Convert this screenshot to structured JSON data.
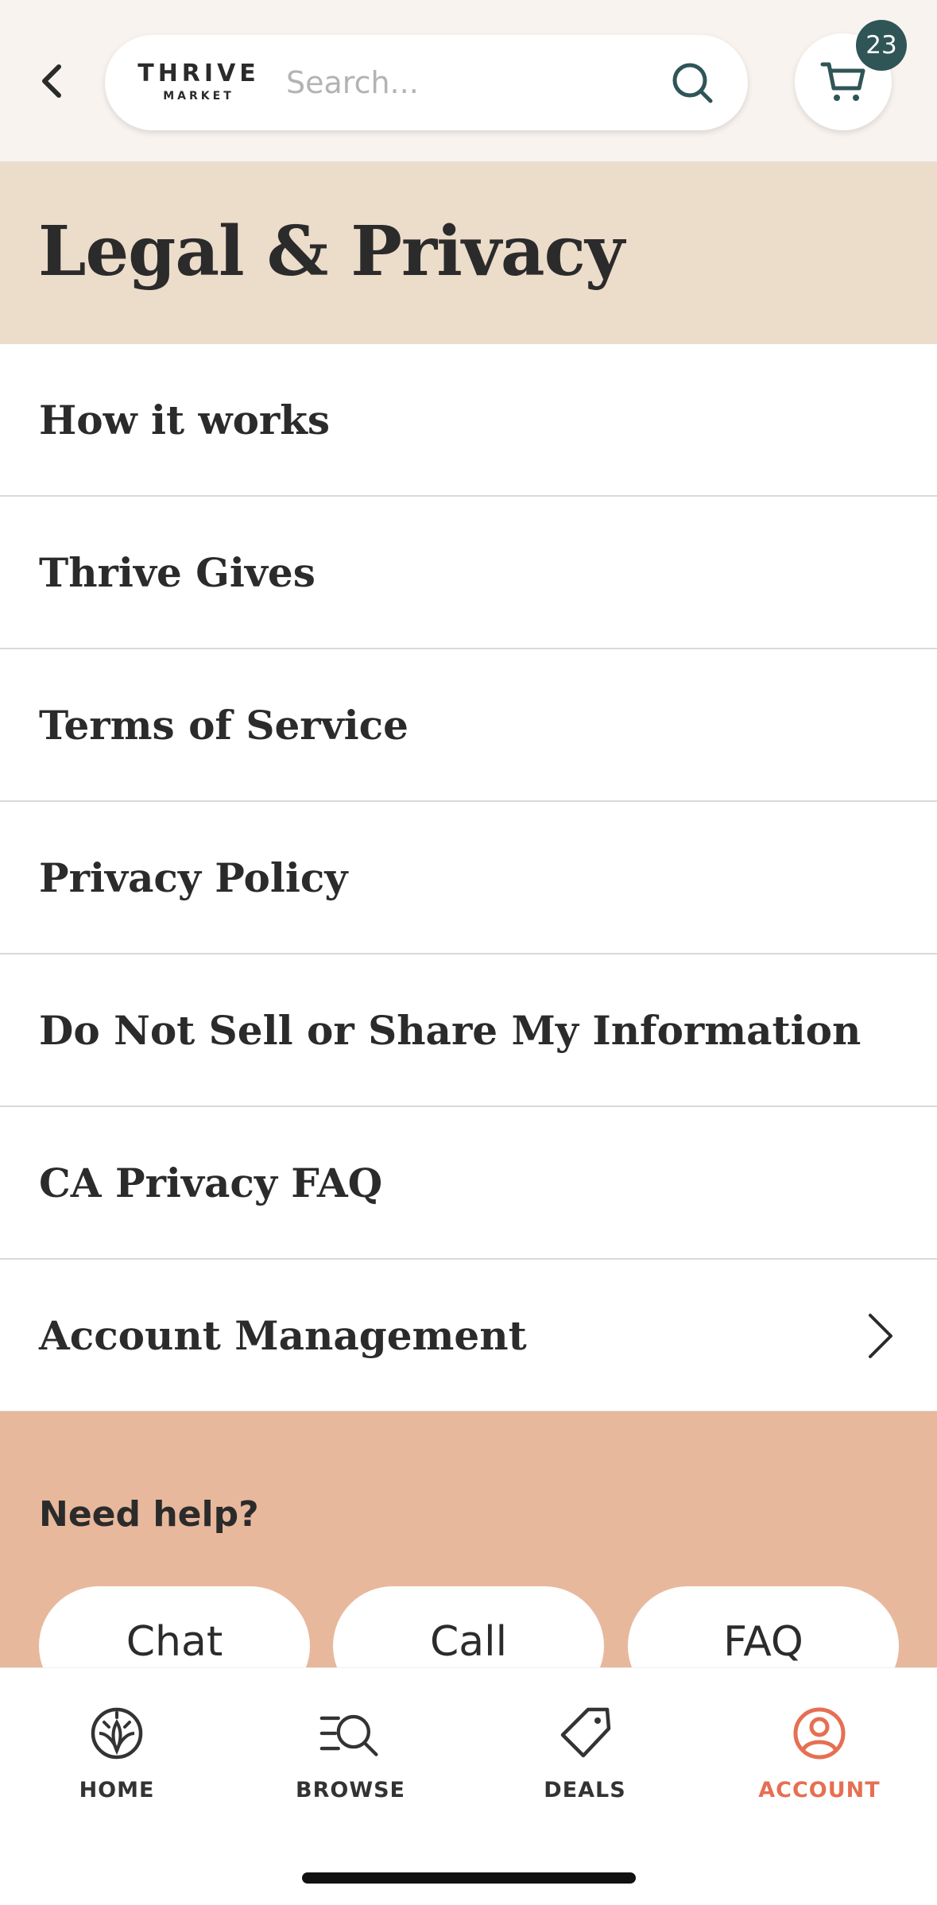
{
  "header": {
    "back_icon": "chevron-left-icon",
    "logo_top": "THRIVE",
    "logo_bottom": "MARKET",
    "search_placeholder": "Search...",
    "search_icon": "search-icon",
    "cart_icon": "cart-icon",
    "cart_count": "23",
    "badge_color": "#2f5557"
  },
  "page": {
    "title": "Legal & Privacy",
    "banner_color": "#ecdcca"
  },
  "menu": {
    "items": [
      {
        "label": "How it works"
      },
      {
        "label": "Thrive Gives"
      },
      {
        "label": "Terms of Service"
      },
      {
        "label": "Privacy Policy"
      },
      {
        "label": "Do Not Sell or Share My Information"
      },
      {
        "label": "CA Privacy FAQ"
      },
      {
        "label": "Account Management",
        "icon": "chevron-right-icon"
      }
    ]
  },
  "help": {
    "title": "Need help?",
    "background_color": "#e8b89d",
    "buttons": [
      {
        "label": "Chat"
      },
      {
        "label": "Call"
      },
      {
        "label": "FAQ"
      }
    ]
  },
  "tabbar": {
    "active_color": "#e66f53",
    "tabs": [
      {
        "label": "HOME",
        "icon": "home-leaf-icon",
        "active": false
      },
      {
        "label": "BROWSE",
        "icon": "browse-search-icon",
        "active": false
      },
      {
        "label": "DEALS",
        "icon": "tag-icon",
        "active": false
      },
      {
        "label": "ACCOUNT",
        "icon": "account-icon",
        "active": true
      }
    ]
  }
}
